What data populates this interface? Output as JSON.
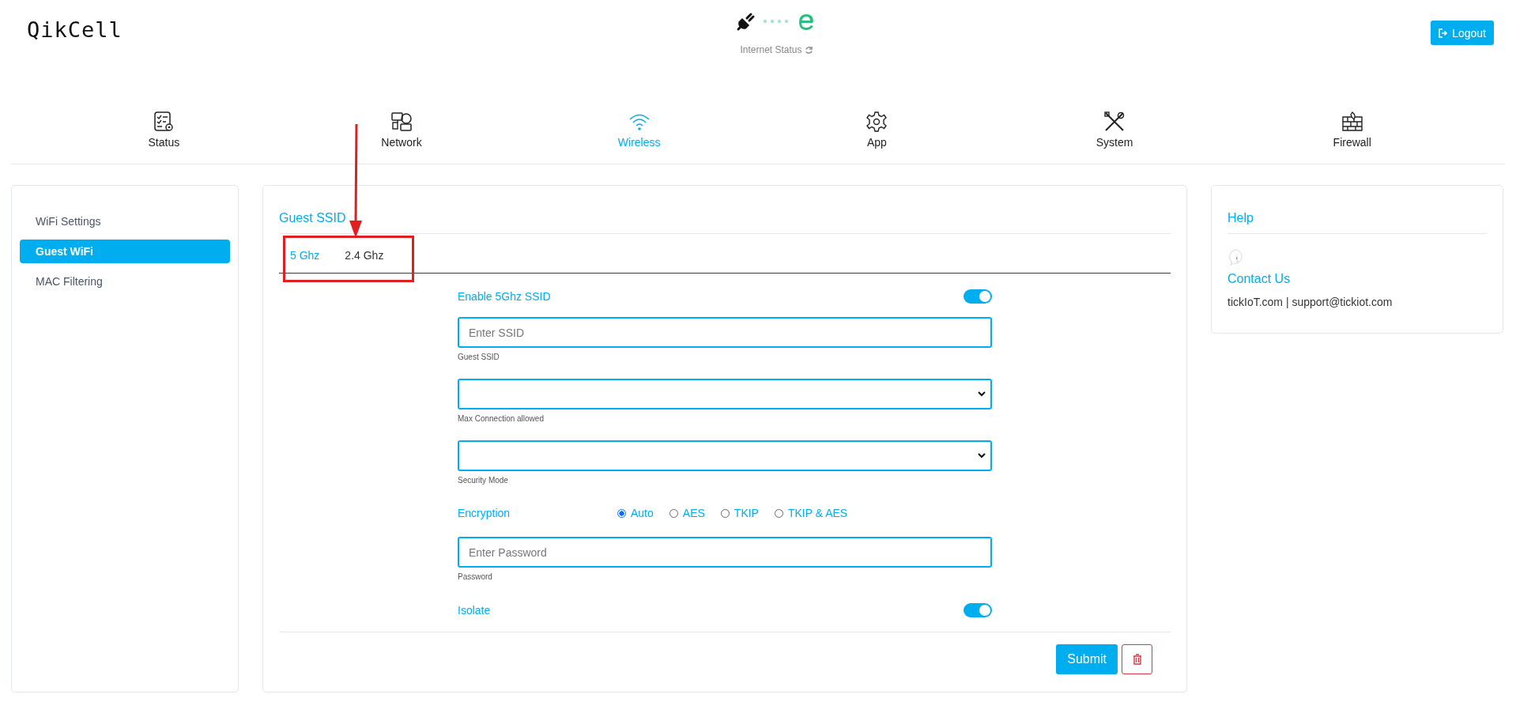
{
  "header": {
    "logo": "QikCell",
    "internet_status": "Internet Status",
    "logout": "Logout"
  },
  "nav": [
    {
      "label": "Status",
      "selected": false
    },
    {
      "label": "Network",
      "selected": false
    },
    {
      "label": "Wireless",
      "selected": true
    },
    {
      "label": "App",
      "selected": false
    },
    {
      "label": "System",
      "selected": false
    },
    {
      "label": "Firewall",
      "selected": false
    }
  ],
  "sidebar": {
    "items": [
      {
        "label": "WiFi Settings",
        "selected": false
      },
      {
        "label": "Guest WiFi",
        "selected": true
      },
      {
        "label": "MAC Filtering",
        "selected": false
      }
    ]
  },
  "main": {
    "title": "Guest SSID",
    "tabs": [
      {
        "label": "5 Ghz",
        "selected": true
      },
      {
        "label": "2.4 Ghz",
        "selected": false
      }
    ],
    "rows": [
      {
        "kind": "toggle",
        "label": "Enable 5Ghz SSID",
        "on": true
      },
      {
        "kind": "input",
        "placeholder": "Enter SSID",
        "caption": "Guest SSID"
      },
      {
        "kind": "select",
        "caption": "Max Connection allowed"
      },
      {
        "kind": "select",
        "caption": "Security Mode"
      },
      {
        "kind": "radio",
        "label": "Encryption",
        "options": [
          {
            "label": "Auto",
            "selected": true
          },
          {
            "label": "AES",
            "selected": false
          },
          {
            "label": "TKIP",
            "selected": false
          },
          {
            "label": "TKIP & AES",
            "selected": false
          }
        ]
      },
      {
        "kind": "input",
        "placeholder": "Enter Password",
        "caption": "Password"
      },
      {
        "kind": "toggle",
        "label": "Isolate",
        "on": true
      }
    ],
    "submit": "Submit"
  },
  "help": {
    "title": "Help",
    "contact_title": "Contact Us",
    "contact_text": "tickIoT.com | support@tickiot.com"
  }
}
